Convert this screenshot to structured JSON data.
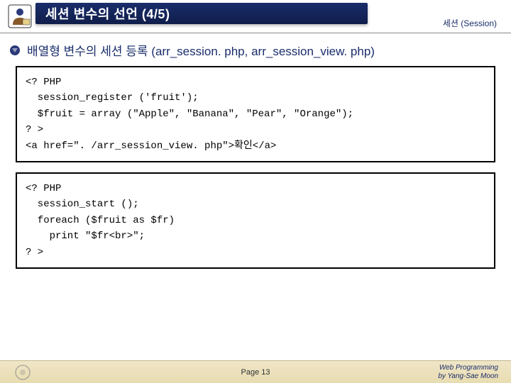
{
  "header": {
    "title": "세션 변수의 선언 (4/5)",
    "right_label": "세션 (Session)"
  },
  "section": {
    "heading": "배열형 변수의 세션 등록 (arr_session. php, arr_session_view. php)"
  },
  "code1": {
    "l1": "<? PHP",
    "l2": "  session_register ('fruit');",
    "l3": "  $fruit = array (\"Apple\", \"Banana\", \"Pear\", \"Orange\");",
    "l4": "? >",
    "l5": "<a href=\". /arr_session_view. php\">확인</a>"
  },
  "code2": {
    "l1": "<? PHP",
    "l2": "  session_start ();",
    "l3": "",
    "l4": "  foreach ($fruit as $fr)",
    "l5": "    print \"$fr<br>\";",
    "l6": "? >"
  },
  "footer": {
    "page": "Page 13",
    "credit1": "Web Programming",
    "credit2": "by Yang-Sae Moon"
  }
}
